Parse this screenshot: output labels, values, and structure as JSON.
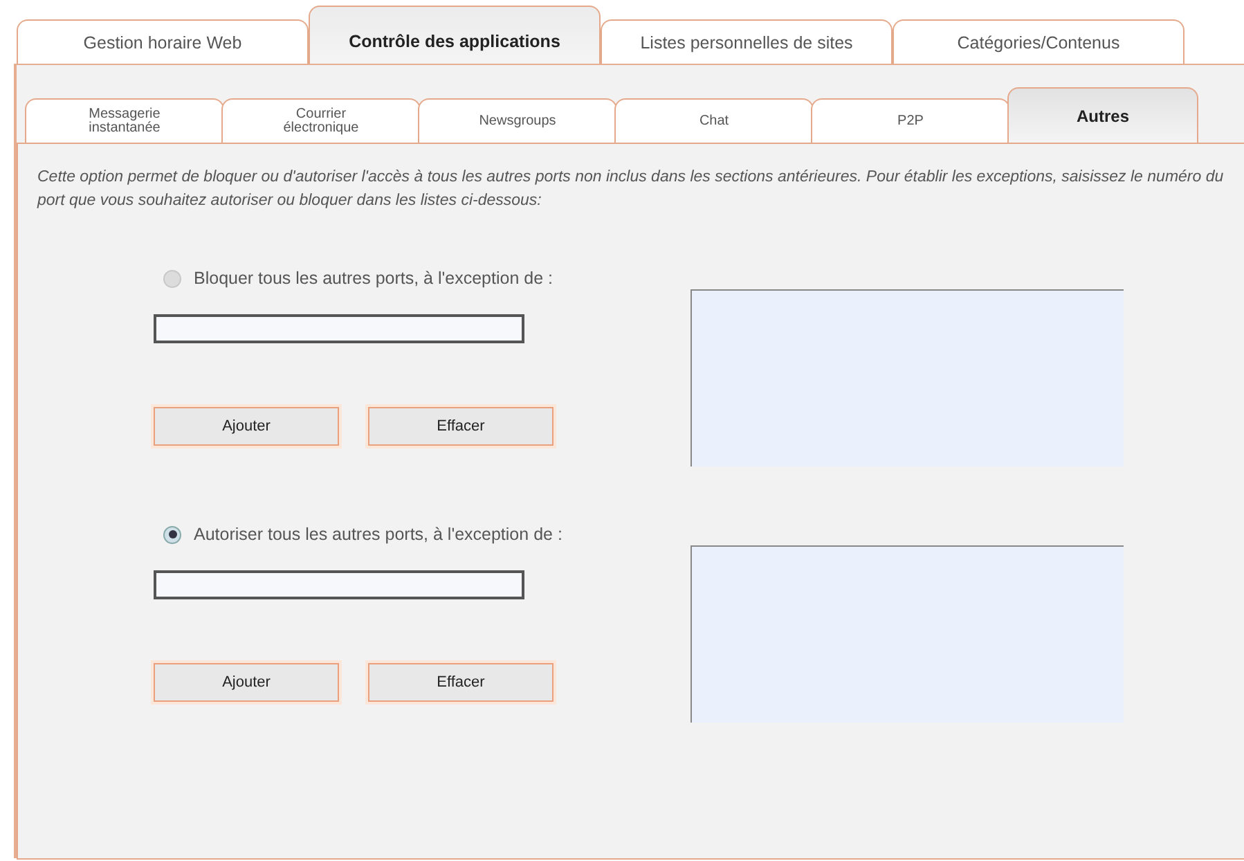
{
  "tabs": [
    {
      "label": "Gestion horaire Web",
      "selected": false
    },
    {
      "label": "Contrôle des applications",
      "selected": true
    },
    {
      "label": "Listes personnelles de sites",
      "selected": false
    },
    {
      "label": "Catégories/Contenus",
      "selected": false
    }
  ],
  "subtabs": [
    {
      "label": "Messagerie\ninstantanée",
      "selected": false
    },
    {
      "label": "Courrier\nélectronique",
      "selected": false
    },
    {
      "label": "Newsgroups",
      "selected": false
    },
    {
      "label": "Chat",
      "selected": false
    },
    {
      "label": "P2P",
      "selected": false
    },
    {
      "label": "Autres",
      "selected": true
    }
  ],
  "description": "Cette option permet de bloquer ou d'autoriser l'accès à tous les autres ports non inclus dans les sections antérieures. Pour établir les exceptions, saisissez le numéro du port que vous souhaitez autoriser ou bloquer dans les listes ci-dessous:",
  "sections": [
    {
      "label": "Bloquer tous les autres ports, à l'exception de :",
      "selected": false,
      "buttons": [
        "Ajouter",
        "Effacer"
      ]
    },
    {
      "label": "Autoriser tous les autres ports, à l'exception de :",
      "selected": true,
      "buttons": [
        "Ajouter",
        "Effacer"
      ]
    }
  ]
}
